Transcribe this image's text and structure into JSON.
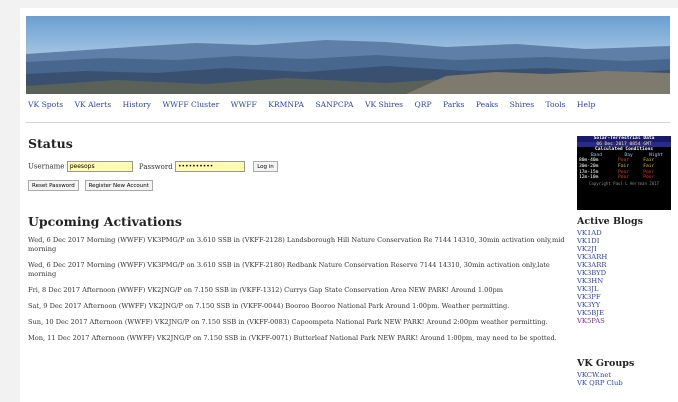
{
  "nav": [
    "VK Spots",
    "VK Alerts",
    "History",
    "WWFF Cluster",
    "WWFF",
    "KRMNPA",
    "SANPCPA",
    "VK Shires",
    "QRP",
    "Parks",
    "Peaks",
    "Shires",
    "Tools",
    "Help"
  ],
  "status": {
    "heading": "Status",
    "username_label": "Username",
    "username_value": "peesops",
    "password_label": "Password",
    "password_value": "••••••••••",
    "login_label": "Log in",
    "reset_label": "Reset Password",
    "register_label": "Register New Account"
  },
  "upcoming": {
    "heading": "Upcoming Activations",
    "items": [
      "Wed, 6 Dec 2017 Morning (WWFF) VK3PMG/P on 3.610 SSB in (VKFF-2128) Landsborough Hill Nature Conservation Re 7144 14310, 30min activation only,mid morning",
      "Wed, 6 Dec 2017 Morning (WWFF) VK3PMG/P on 3.610 SSB in (VKFF-2180) Redbank Nature Conservation Reserve 7144 14310, 30min activation only,late morning",
      "Fri, 8 Dec 2017 Afternoon (WWFF) VK2JNG/P on 7.150 SSB in (VKFF-1312) Currys Gap State Conservation Area NEW PARK! Around 1.00pm",
      "Sat, 9 Dec 2017 Afternoon (WWFF) VK2JNG/P on 7.150 SSB in (VKFF-0044) Booroo Booroo National Park Around 1:00pm. Weather permitting.",
      "Sun, 10 Dec 2017 Afternoon (WWFF) VK2JNG/P on 7.150 SSB in (VKFF-0083) Capoompeta National Park NEW PARK! Around 2:00pm weather permitting.",
      "Mon, 11 Dec 2017 Afternoon (WWFF) VK2JNG/P on 7.150 SSB in (VKFF-0071) Butterleaf National Park NEW PARK! Around 1:00pm, may need to be spotted."
    ]
  },
  "solar": {
    "title": "Solar-Terrestrial Data",
    "date": "06 Dec 2017 0854 GMT",
    "calc": "Calculated Conditions",
    "cols": [
      "Band",
      "Day",
      "Night"
    ],
    "rows": [
      {
        "band": "80m-40m",
        "day": "Poor",
        "night": "Fair"
      },
      {
        "band": "30m-20m",
        "day": "Fair",
        "night": "Fair"
      },
      {
        "band": "17m-15m",
        "day": "Poor",
        "night": "Poor"
      },
      {
        "band": "12m-10m",
        "day": "Poor",
        "night": "Poor"
      }
    ],
    "footer": "Copyright Paul L Herrman 2017"
  },
  "colors": {
    "poor": "#ff3030",
    "fair": "#ffcc00",
    "link": "#2a3fbf"
  },
  "active_blogs": {
    "heading": "Active Blogs",
    "items": [
      "VK1AD",
      "VK1DI",
      "VK2JI",
      "VK3ARH",
      "VK3ARR",
      "VK3BYD",
      "VK3HN",
      "VK3JL",
      "VK3PF",
      "VK3YY",
      "VK5BJE",
      "VK5PAS"
    ]
  },
  "vk_groups": {
    "heading": "VK Groups",
    "items": [
      "VKCW.net",
      "VK QRP Club"
    ]
  }
}
